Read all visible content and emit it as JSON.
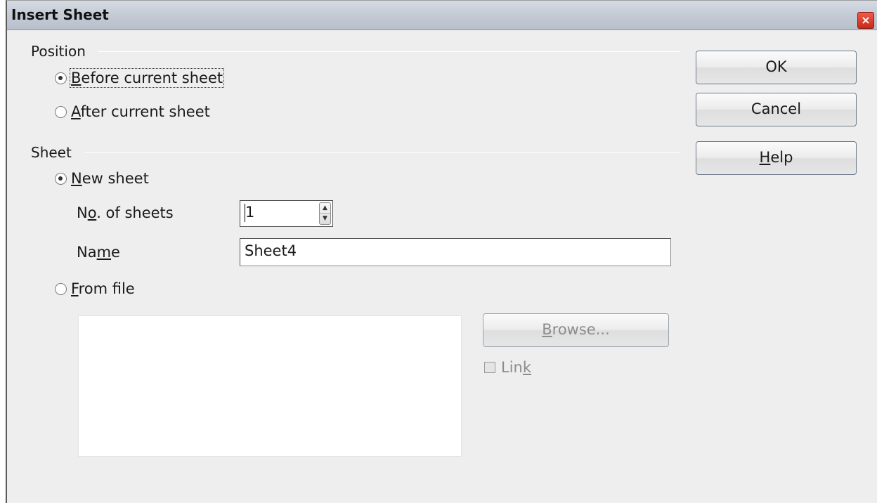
{
  "window": {
    "title": "Insert Sheet",
    "close_glyph": "×"
  },
  "position": {
    "group_label": "Position",
    "before": {
      "mnemonic": "B",
      "rest": "efore current sheet",
      "checked": true
    },
    "after": {
      "mnemonic": "A",
      "rest": "fter current sheet",
      "checked": false
    }
  },
  "sheet": {
    "group_label": "Sheet",
    "new_sheet": {
      "mnemonic": "N",
      "rest": "ew sheet",
      "checked": true
    },
    "count_label": {
      "pre": "N",
      "mnemonic": "o",
      "rest": ". of sheets"
    },
    "count_value": "1",
    "name_label": {
      "pre": "Na",
      "mnemonic": "m",
      "rest": "e"
    },
    "name_value": "Sheet4",
    "from_file": {
      "mnemonic": "F",
      "rest": "rom file",
      "checked": false
    },
    "link": {
      "pre": "Lin",
      "mnemonic": "k",
      "rest": "",
      "checked": false
    }
  },
  "buttons": {
    "ok": "OK",
    "cancel": "Cancel",
    "help": {
      "mnemonic": "H",
      "rest": "elp"
    },
    "browse": {
      "mnemonic": "B",
      "rest": "rowse..."
    }
  }
}
